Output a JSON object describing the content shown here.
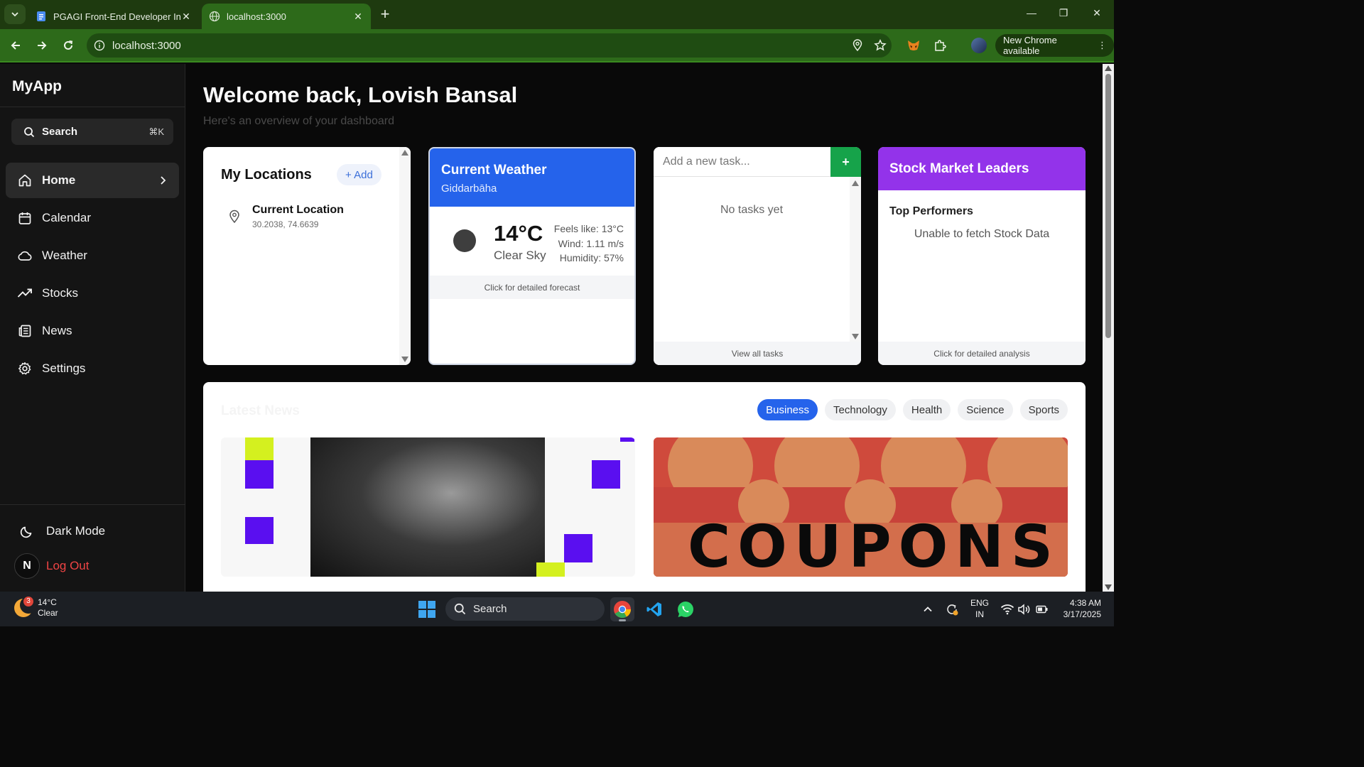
{
  "browser": {
    "tabs": [
      {
        "title": "PGAGI Front-End Developer Int",
        "active": false
      },
      {
        "title": "localhost:3000",
        "active": true
      }
    ],
    "url": "localhost:3000",
    "update_label": "New Chrome available"
  },
  "sidebar": {
    "brand": "MyApp",
    "search_label": "Search",
    "search_shortcut": "⌘K",
    "nav": [
      {
        "label": "Home",
        "icon": "home-icon",
        "active": true
      },
      {
        "label": "Calendar",
        "icon": "calendar-icon",
        "active": false
      },
      {
        "label": "Weather",
        "icon": "cloud-icon",
        "active": false
      },
      {
        "label": "Stocks",
        "icon": "trending-up-icon",
        "active": false
      },
      {
        "label": "News",
        "icon": "newspaper-icon",
        "active": false
      },
      {
        "label": "Settings",
        "icon": "gear-icon",
        "active": false
      }
    ],
    "dark_mode_label": "Dark Mode",
    "avatar_letter": "N",
    "logout_label": "Log Out"
  },
  "main": {
    "welcome": "Welcome back, Lovish Bansal",
    "subtitle": "Here's an overview of your dashboard"
  },
  "locations": {
    "title": "My Locations",
    "add_label": "+ Add",
    "items": [
      {
        "name": "Current Location",
        "coords": "30.2038, 74.6639"
      }
    ]
  },
  "weather": {
    "title": "Current Weather",
    "city": "Giddarbāha",
    "temp": "14°C",
    "condition": "Clear Sky",
    "feels_like": "Feels like: 13°C",
    "wind": "Wind: 1.11 m/s",
    "humidity": "Humidity: 57%",
    "footer": "Click for detailed forecast"
  },
  "tasks": {
    "placeholder": "Add a new task...",
    "add_symbol": "+",
    "empty": "No tasks yet",
    "footer": "View all tasks"
  },
  "stocks": {
    "title": "Stock Market Leaders",
    "subtitle": "Top Performers",
    "error": "Unable to fetch Stock Data",
    "footer": "Click for detailed analysis"
  },
  "news": {
    "title": "Latest News",
    "categories": [
      "Business",
      "Technology",
      "Health",
      "Science",
      "Sports"
    ],
    "active_category": "Business",
    "article_image_text": "COUPONS"
  },
  "taskbar": {
    "weather_temp": "14°C",
    "weather_desc": "Clear",
    "weather_badge": "3",
    "search_label": "Search",
    "lang": "ENG",
    "region": "IN",
    "time": "4:38 AM",
    "date": "3/17/2025"
  },
  "colors": {
    "chrome_frame": "#1e3a0f",
    "chrome_toolbar": "#2d6a1a",
    "weather_header": "#2563eb",
    "stocks_header": "#9333ea",
    "task_add": "#16a34a",
    "logout": "#ef4444"
  }
}
